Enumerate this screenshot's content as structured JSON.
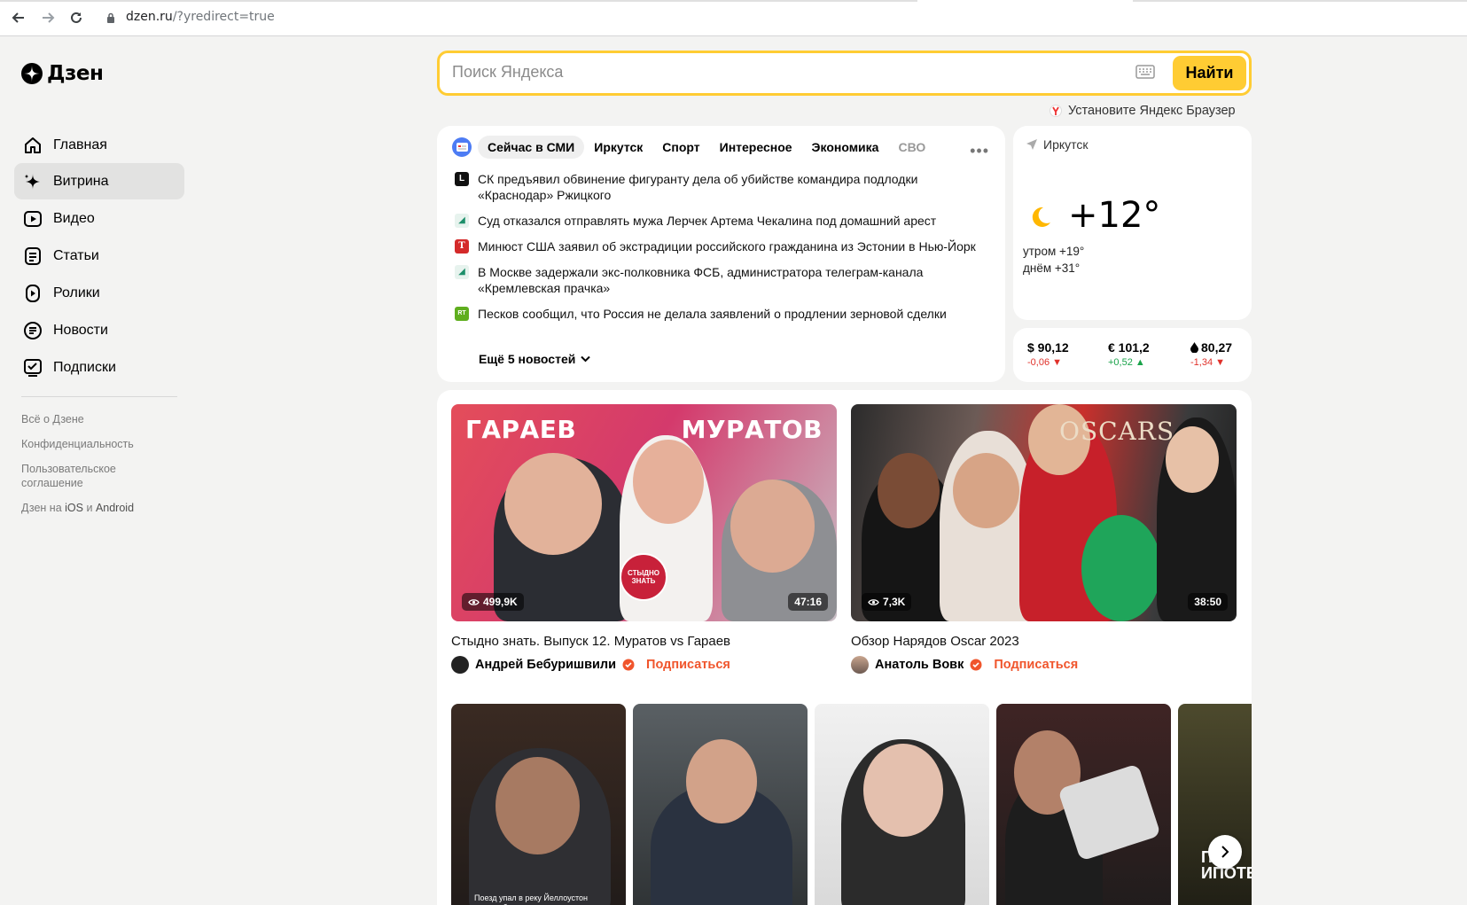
{
  "browser": {
    "url_host": "dzen.ru",
    "url_path": "/?yredirect=true"
  },
  "sidebar": {
    "logo": "Дзен",
    "items": [
      {
        "label": "Главная"
      },
      {
        "label": "Витрина"
      },
      {
        "label": "Видео"
      },
      {
        "label": "Статьи"
      },
      {
        "label": "Ролики"
      },
      {
        "label": "Новости"
      },
      {
        "label": "Подписки"
      }
    ],
    "footer_links": [
      "Всё о Дзене",
      "Конфиденциальность",
      "Пользовательское соглашение"
    ],
    "apps": {
      "prefix": "Дзен на",
      "ios": "iOS",
      "and": "и",
      "android": "Android"
    }
  },
  "search": {
    "placeholder": "Поиск Яндекса",
    "button": "Найти",
    "promo": "Установите Яндекс Браузер"
  },
  "news": {
    "tabs": [
      "Сейчас в СМИ",
      "Иркутск",
      "Спорт",
      "Интересное",
      "Экономика",
      "СВО"
    ],
    "items": [
      {
        "source_icon": "L",
        "text": "СК предъявил обвинение фигуранту дела об убийстве командира подлодки «Краснодар» Ржицкого"
      },
      {
        "source_icon": "◢",
        "text": "Суд отказался отправлять мужа Лерчек Артема Чекалина под домашний арест"
      },
      {
        "source_icon": "T",
        "text": "Минюст США заявил об экстрадиции российского гражданина из Эстонии в Нью-Йорк"
      },
      {
        "source_icon": "◢",
        "text": "В Москве задержали экс-полковника ФСБ, администратора телеграм-канала «Кремлевская прачка»"
      },
      {
        "source_icon": "RT",
        "text": "Песков сообщил, что Россия не делала заявлений о продлении зерновой сделки"
      }
    ],
    "more": "Ещё 5 новостей"
  },
  "weather": {
    "city": "Иркутск",
    "temp": "+12°",
    "morning": "утром +19°",
    "day": "днём +31°"
  },
  "currency": [
    {
      "value": "$ 90,12",
      "delta": "-0,06 ▼",
      "trend": "down"
    },
    {
      "value": "€ 101,2",
      "delta": "+0,52 ▲",
      "trend": "up"
    },
    {
      "value": "80,27",
      "delta": "-1,34 ▼",
      "trend": "down",
      "icon": "oil-drop-icon"
    }
  ],
  "videos": [
    {
      "thumb_left": "ГАРАЕВ",
      "thumb_right": "МУРАТОВ",
      "sticker": "СТЫДНО ЗНАТЬ",
      "views": "499,9K",
      "duration": "47:16",
      "title": "Стыдно знать. Выпуск 12. Муратов vs Гараев",
      "author": "Андрей Бебуришвили",
      "subscribe": "Подписаться"
    },
    {
      "thumb_text": "OSCARS",
      "views": "7,3K",
      "duration": "38:50",
      "title": "Обзор Нарядов Oscar 2023",
      "author": "Анатоль Вовк",
      "subscribe": "Подписаться"
    }
  ],
  "shorts": [
    {
      "caption": "Поезд упал в реку Йеллоустон после обрушения моста"
    },
    {
      "caption": ""
    },
    {
      "caption": ""
    },
    {
      "caption": ""
    },
    {
      "caption": "ПОХ ИПОТЕ"
    }
  ],
  "colors": {
    "accent": "#ffcc33",
    "subscribe": "#f0552c",
    "down": "#e0312a",
    "up": "#1aa34a"
  }
}
